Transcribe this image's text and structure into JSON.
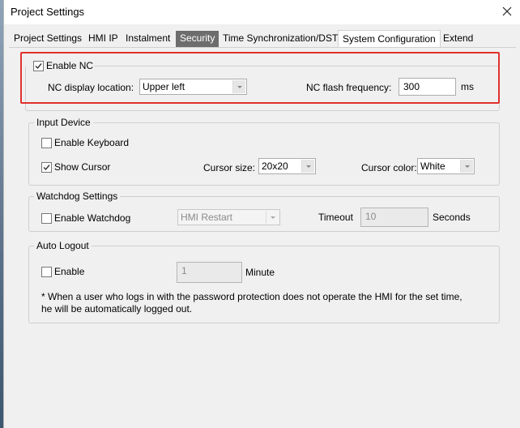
{
  "window": {
    "title": "Project Settings"
  },
  "tabs": [
    {
      "label": "Project Settings"
    },
    {
      "label": "HMI IP"
    },
    {
      "label": "Instalment"
    },
    {
      "label": "Security"
    },
    {
      "label": "Time Synchronization/DST"
    },
    {
      "label": "System Configuration"
    },
    {
      "label": "Extend"
    }
  ],
  "nc": {
    "enable_label": "Enable NC",
    "enabled": true,
    "location_label": "NC display location:",
    "location_value": "Upper left",
    "flash_label": "NC flash frequency:",
    "flash_value": "300",
    "flash_unit": "ms"
  },
  "input_device": {
    "title": "Input Device",
    "keyboard_label": "Enable Keyboard",
    "keyboard_checked": false,
    "cursor_label": "Show Cursor",
    "cursor_checked": true,
    "cursor_size_label": "Cursor size:",
    "cursor_size_value": "20x20",
    "cursor_color_label": "Cursor color:",
    "cursor_color_value": "White"
  },
  "watchdog": {
    "title": "Watchdog Settings",
    "enable_label": "Enable Watchdog",
    "enabled": false,
    "action_value": "HMI Restart",
    "timeout_label": "Timeout",
    "timeout_value": "10",
    "timeout_unit": "Seconds"
  },
  "auto_logout": {
    "title": "Auto Logout",
    "enable_label": "Enable",
    "enabled": false,
    "minutes_value": "1",
    "minutes_unit": "Minute",
    "note": "* When a user who logs in with the password protection does not operate the HMI for the set time, he will be automatically logged out."
  },
  "colors": {
    "highlight": "#e0312c",
    "selected_tab_bg": "#6d6d6d",
    "window_bg": "#f0f0f0"
  },
  "icons": {
    "close": "close-icon",
    "check": "checkmark-icon",
    "dropdown": "chevron-down-icon"
  }
}
